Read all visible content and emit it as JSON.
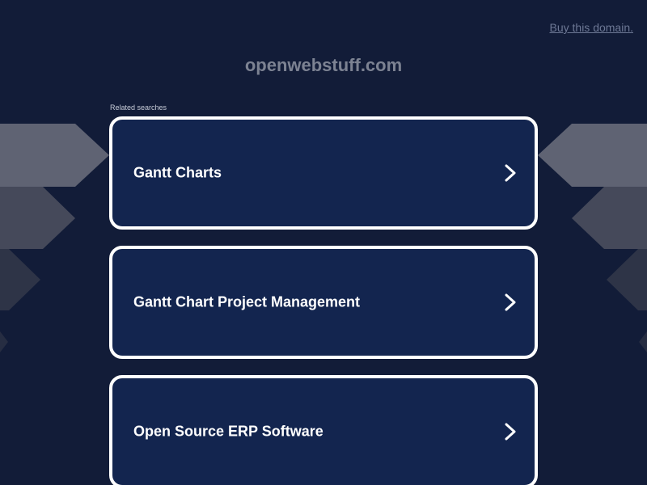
{
  "header": {
    "buy_link": "Buy this domain.",
    "domain": "openwebstuff.com"
  },
  "related": {
    "label": "Related searches",
    "items": [
      {
        "label": "Gantt Charts",
        "icon": "chevron-right-icon"
      },
      {
        "label": "Gantt Chart Project Management",
        "icon": "chevron-right-icon"
      },
      {
        "label": "Open Source ERP Software",
        "icon": "chevron-right-icon"
      }
    ]
  },
  "colors": {
    "background": "#121c38",
    "card": "#13254f",
    "card_border": "#ffffff",
    "title": "#7c8292",
    "link": "#6d7895"
  }
}
